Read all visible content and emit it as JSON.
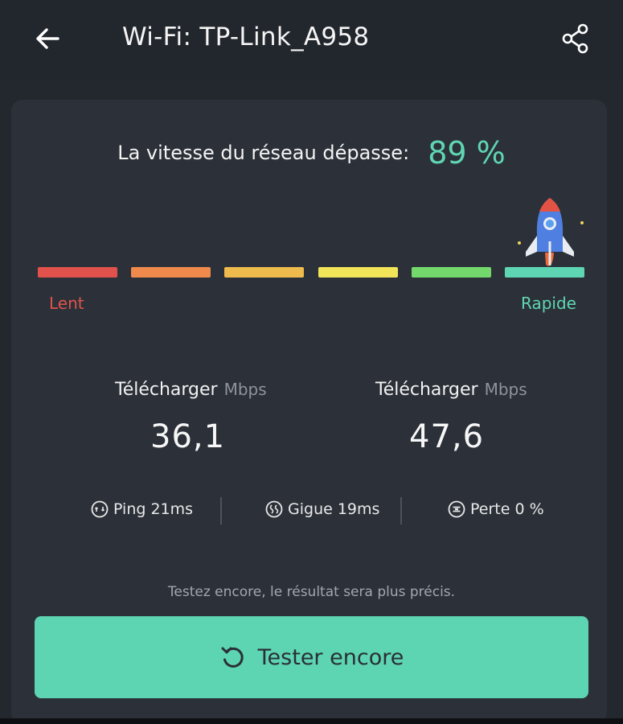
{
  "header": {
    "title": "Wi-Fi: TP-Link_A958",
    "back_icon": "arrow-left-icon",
    "share_icon": "share-icon"
  },
  "result": {
    "label": "La vitesse du réseau dépasse:",
    "percent": "89 %",
    "percent_value": 89
  },
  "scale": {
    "colors": [
      "#e0524b",
      "#ef8a4c",
      "#efbb4d",
      "#f1e458",
      "#74d96c",
      "#5fd6b3"
    ],
    "slow_label": "Lent",
    "fast_label": "Rapide",
    "accent": "#5fd6b3"
  },
  "stats": [
    {
      "label": "Télécharger",
      "unit": "Mbps",
      "value": "36,1"
    },
    {
      "label": "Télécharger",
      "unit": "Mbps",
      "value": "47,6"
    }
  ],
  "metrics": [
    {
      "icon": "ping-icon",
      "text": "Ping 21ms"
    },
    {
      "icon": "jitter-icon",
      "text": "Gigue 19ms"
    },
    {
      "icon": "loss-icon",
      "text": "Perte 0 %"
    }
  ],
  "footer": {
    "hint": "Testez encore, le résultat sera plus précis.",
    "button_label": "Tester encore",
    "button_icon": "retry-icon"
  }
}
